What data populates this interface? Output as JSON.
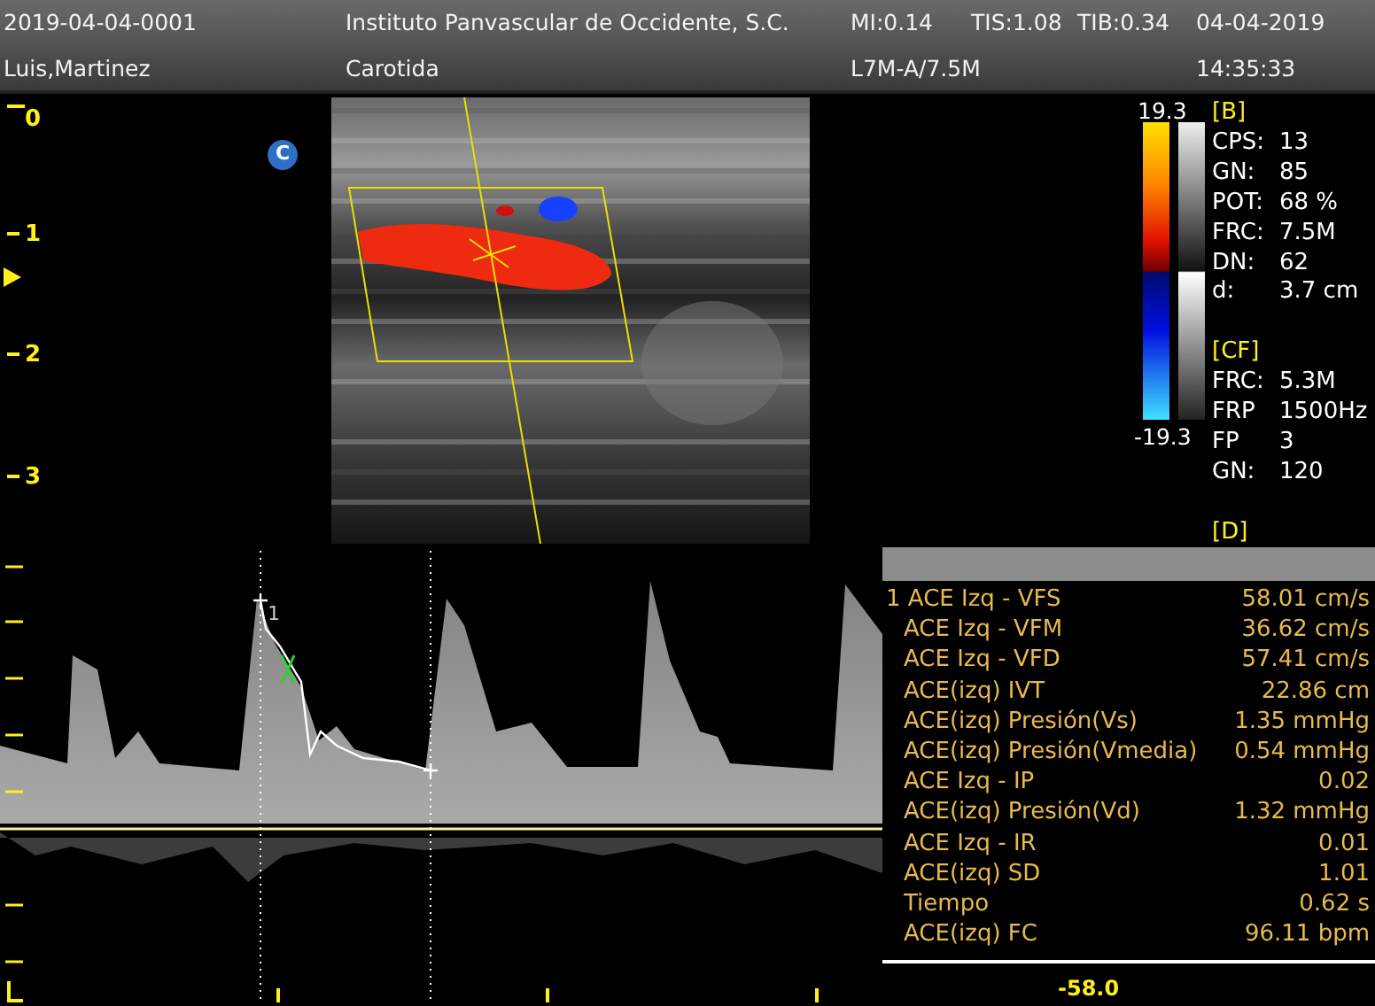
{
  "header": {
    "patient_id": "2019-04-04-0001",
    "institution": "Instituto Panvascular de Occidente, S.C.",
    "mi": "MI:0.14",
    "tis": "TIS:1.08",
    "tib": "TIB:0.34",
    "date": "04-04-2019",
    "patient_name": "Luis,Martinez",
    "exam": "Carotida",
    "probe": "L7M-A/7.5M",
    "time": "14:35:33"
  },
  "depth_scale": {
    "ticks": [
      "0",
      "1",
      "2",
      "3"
    ]
  },
  "mode_badge": "C",
  "color_bar": {
    "max": "19.3",
    "min": "-19.3"
  },
  "parameters": [
    {
      "title": "[B]",
      "rows": [
        {
          "label": "CPS:",
          "value": "13"
        },
        {
          "label": "GN:",
          "value": "85"
        },
        {
          "label": "POT:",
          "value": "68 %"
        },
        {
          "label": "FRC:",
          "value": "7.5M"
        },
        {
          "label": "DN:",
          "value": "62"
        },
        {
          "label": "d:",
          "value": "3.7 cm"
        }
      ]
    },
    {
      "title": "[CF]",
      "rows": [
        {
          "label": "FRC:",
          "value": "5.3M"
        },
        {
          "label": "FRP",
          "value": "1500Hz"
        },
        {
          "label": "FP",
          "value": "3"
        },
        {
          "label": "GN:",
          "value": "120"
        }
      ]
    },
    {
      "title": "[D]"
    }
  ],
  "spectrum": {
    "trace_label": "1",
    "baseline_velocity": "-58.0"
  },
  "measurements": [
    {
      "index": "1",
      "label": "ACE Izq - VFS",
      "value": "58.01 cm/s"
    },
    {
      "label": "ACE Izq - VFM",
      "value": "36.62 cm/s"
    },
    {
      "label": "ACE Izq - VFD",
      "value": "57.41 cm/s"
    },
    {
      "label": "ACE(izq) IVT",
      "value": "22.86 cm"
    },
    {
      "label": "ACE(izq) Presión(Vs)",
      "value": "1.35 mmHg"
    },
    {
      "label": "ACE(izq) Presión(Vmedia)",
      "value": "0.54 mmHg"
    },
    {
      "label": "ACE Izq - IP",
      "value": "0.02"
    },
    {
      "label": "ACE(izq) Presión(Vd)",
      "value": "1.32 mmHg"
    },
    {
      "label": "ACE Izq - IR",
      "value": "0.01"
    },
    {
      "label": "ACE(izq) SD",
      "value": "1.01"
    },
    {
      "label": "Tiempo",
      "value": "0.62 s"
    },
    {
      "label": "ACE(izq) FC",
      "value": "96.11 bpm"
    }
  ]
}
